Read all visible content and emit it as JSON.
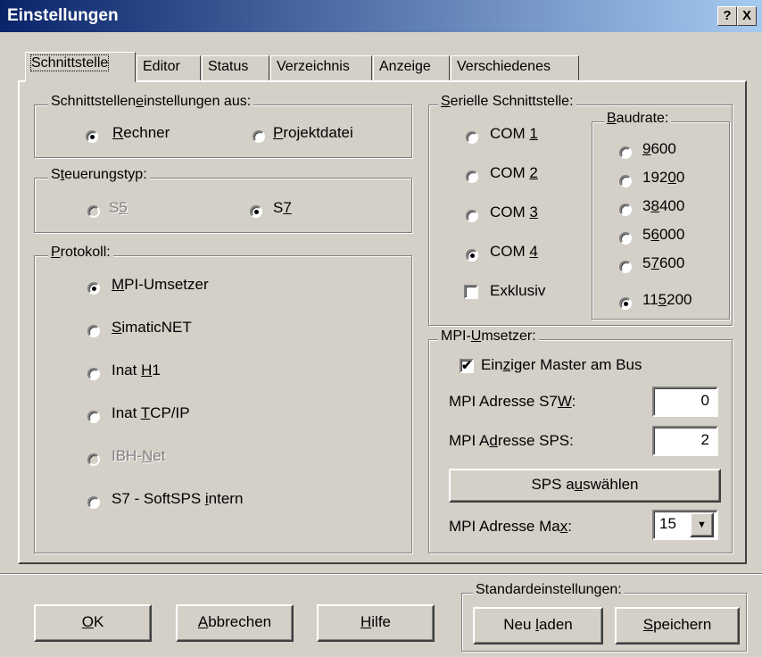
{
  "window": {
    "title": "Einstellungen",
    "help_label": "?",
    "close_label": "X"
  },
  "tabs": [
    {
      "label": "Schnittstelle",
      "active": true
    },
    {
      "label": "Editor"
    },
    {
      "label": "Status"
    },
    {
      "label": "Verzeichnis"
    },
    {
      "label": "Anzeige"
    },
    {
      "label": "Verschiedenes"
    }
  ],
  "settings_source": {
    "title_pre": "Schnittstellen",
    "title_u": "e",
    "title_post": "instellungen aus:",
    "opt1_u": "R",
    "opt1_rest": "echner",
    "opt2_u": "P",
    "opt2_rest": "rojektdatei",
    "selected": "Rechner"
  },
  "control_type": {
    "title_pre": "S",
    "title_u": "t",
    "title_post": "euerungstyp:",
    "opt1_pre": "S",
    "opt1_u": "5",
    "opt1_disabled": true,
    "opt2_pre": "S",
    "opt2_u": "7",
    "selected": "S7"
  },
  "protocol": {
    "title_u": "P",
    "title_rest": "rotokoll:",
    "items": [
      {
        "pre": "",
        "u": "M",
        "post": "PI-Umsetzer",
        "checked": true
      },
      {
        "pre": "",
        "u": "S",
        "post": "imaticNET"
      },
      {
        "pre": "Inat ",
        "u": "H",
        "post": "1"
      },
      {
        "pre": "Inat ",
        "u": "T",
        "post": "CP/IP"
      },
      {
        "pre": "IBH-",
        "u": "N",
        "post": "et",
        "disabled": true
      },
      {
        "pre": "S7 - SoftSPS ",
        "u": "i",
        "post": "ntern"
      }
    ]
  },
  "serial": {
    "title_u": "S",
    "title_rest": "erielle Schnittstelle:",
    "ports": [
      {
        "pre": "COM ",
        "u": "1"
      },
      {
        "pre": "COM ",
        "u": "2"
      },
      {
        "pre": "COM ",
        "u": "3"
      },
      {
        "pre": "COM ",
        "u": "4",
        "checked": true
      }
    ],
    "exclusive_label": "Exklusiv",
    "exclusive_checked": false,
    "baud_title_u": "B",
    "baud_title_rest": "audrate:",
    "baud": [
      {
        "pre": "",
        "u": "9",
        "post": "600"
      },
      {
        "pre": "192",
        "u": "0",
        "post": "0"
      },
      {
        "pre": "3",
        "u": "8",
        "post": "400"
      },
      {
        "pre": "5",
        "u": "6",
        "post": "000"
      },
      {
        "pre": "5",
        "u": "7",
        "post": "600"
      },
      {
        "pre": "11",
        "u": "5",
        "post": "200",
        "checked": true
      }
    ]
  },
  "mpi": {
    "title_pre": "MPI-",
    "title_u": "U",
    "title_post": "msetzer:",
    "single_master_pre": "Ein",
    "single_master_u": "z",
    "single_master_post": "iger Master am Bus",
    "single_master_checked": true,
    "addr_s7w_pre": "MPI Adresse S7",
    "addr_s7w_u": "W",
    "addr_s7w_post": ":",
    "addr_s7w_value": "0",
    "addr_sps_pre": "MPI A",
    "addr_sps_u": "d",
    "addr_sps_post": "resse SPS:",
    "addr_sps_value": "2",
    "select_sps_pre": "SPS a",
    "select_sps_u": "u",
    "select_sps_post": "swählen",
    "addr_max_pre": "MPI Adresse Ma",
    "addr_max_u": "x",
    "addr_max_post": ":",
    "addr_max_value": "15"
  },
  "buttons": {
    "ok_u": "O",
    "ok_rest": "K",
    "cancel_u": "A",
    "cancel_rest": "bbrechen",
    "help_u": "H",
    "help_rest": "ilfe"
  },
  "defaults": {
    "title": "Standardeinstellungen:",
    "reload_pre": "Neu ",
    "reload_u": "l",
    "reload_post": "aden",
    "save_u": "S",
    "save_rest": "peichern"
  }
}
